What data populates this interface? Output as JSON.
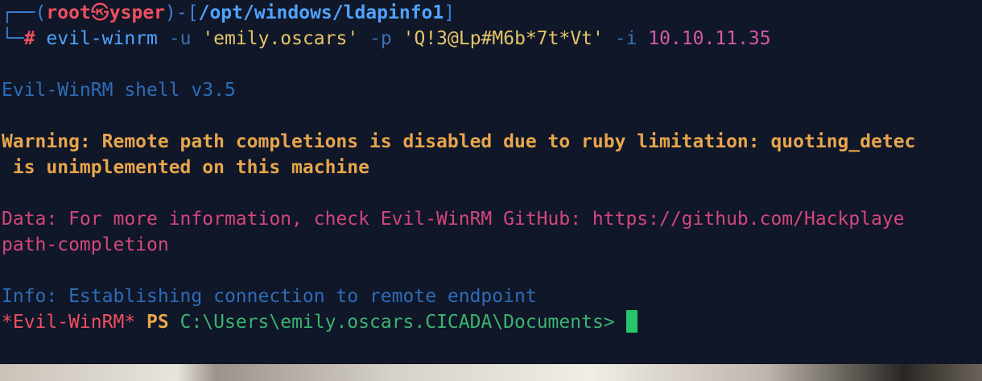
{
  "prompt": {
    "corner_top": "┌──",
    "corner_bottom": "└─",
    "user": "root",
    "separator": "㉿",
    "host": "ysper",
    "dash": ")-[",
    "open_paren": "(",
    "path": "/opt/windows/ldapinfo1",
    "close_bracket": "]",
    "hash": "#"
  },
  "command": {
    "program": "evil-winrm",
    "flag_u": "-u",
    "user_arg": "'emily.oscars'",
    "flag_p": "-p",
    "password_arg": "'Q!3@Lp#M6b*7t*Vt'",
    "flag_i": "-i",
    "ip": "10.10.11.35"
  },
  "output": {
    "banner": "Evil-WinRM shell v3.5",
    "warning_line1": "Warning: Remote path completions is disabled due to ruby limitation: quoting_detec",
    "warning_line2": " is unimplemented on this machine",
    "data_line1": "Data: For more information, check Evil-WinRM GitHub: https://github.com/Hackplaye",
    "data_line2": "path-completion",
    "info": "Info: Establishing connection to remote endpoint"
  },
  "ps_prompt": {
    "name": "*Evil-WinRM*",
    "ps": "PS",
    "path": "C:\\Users\\emily.oscars.CICADA\\Documents>"
  }
}
